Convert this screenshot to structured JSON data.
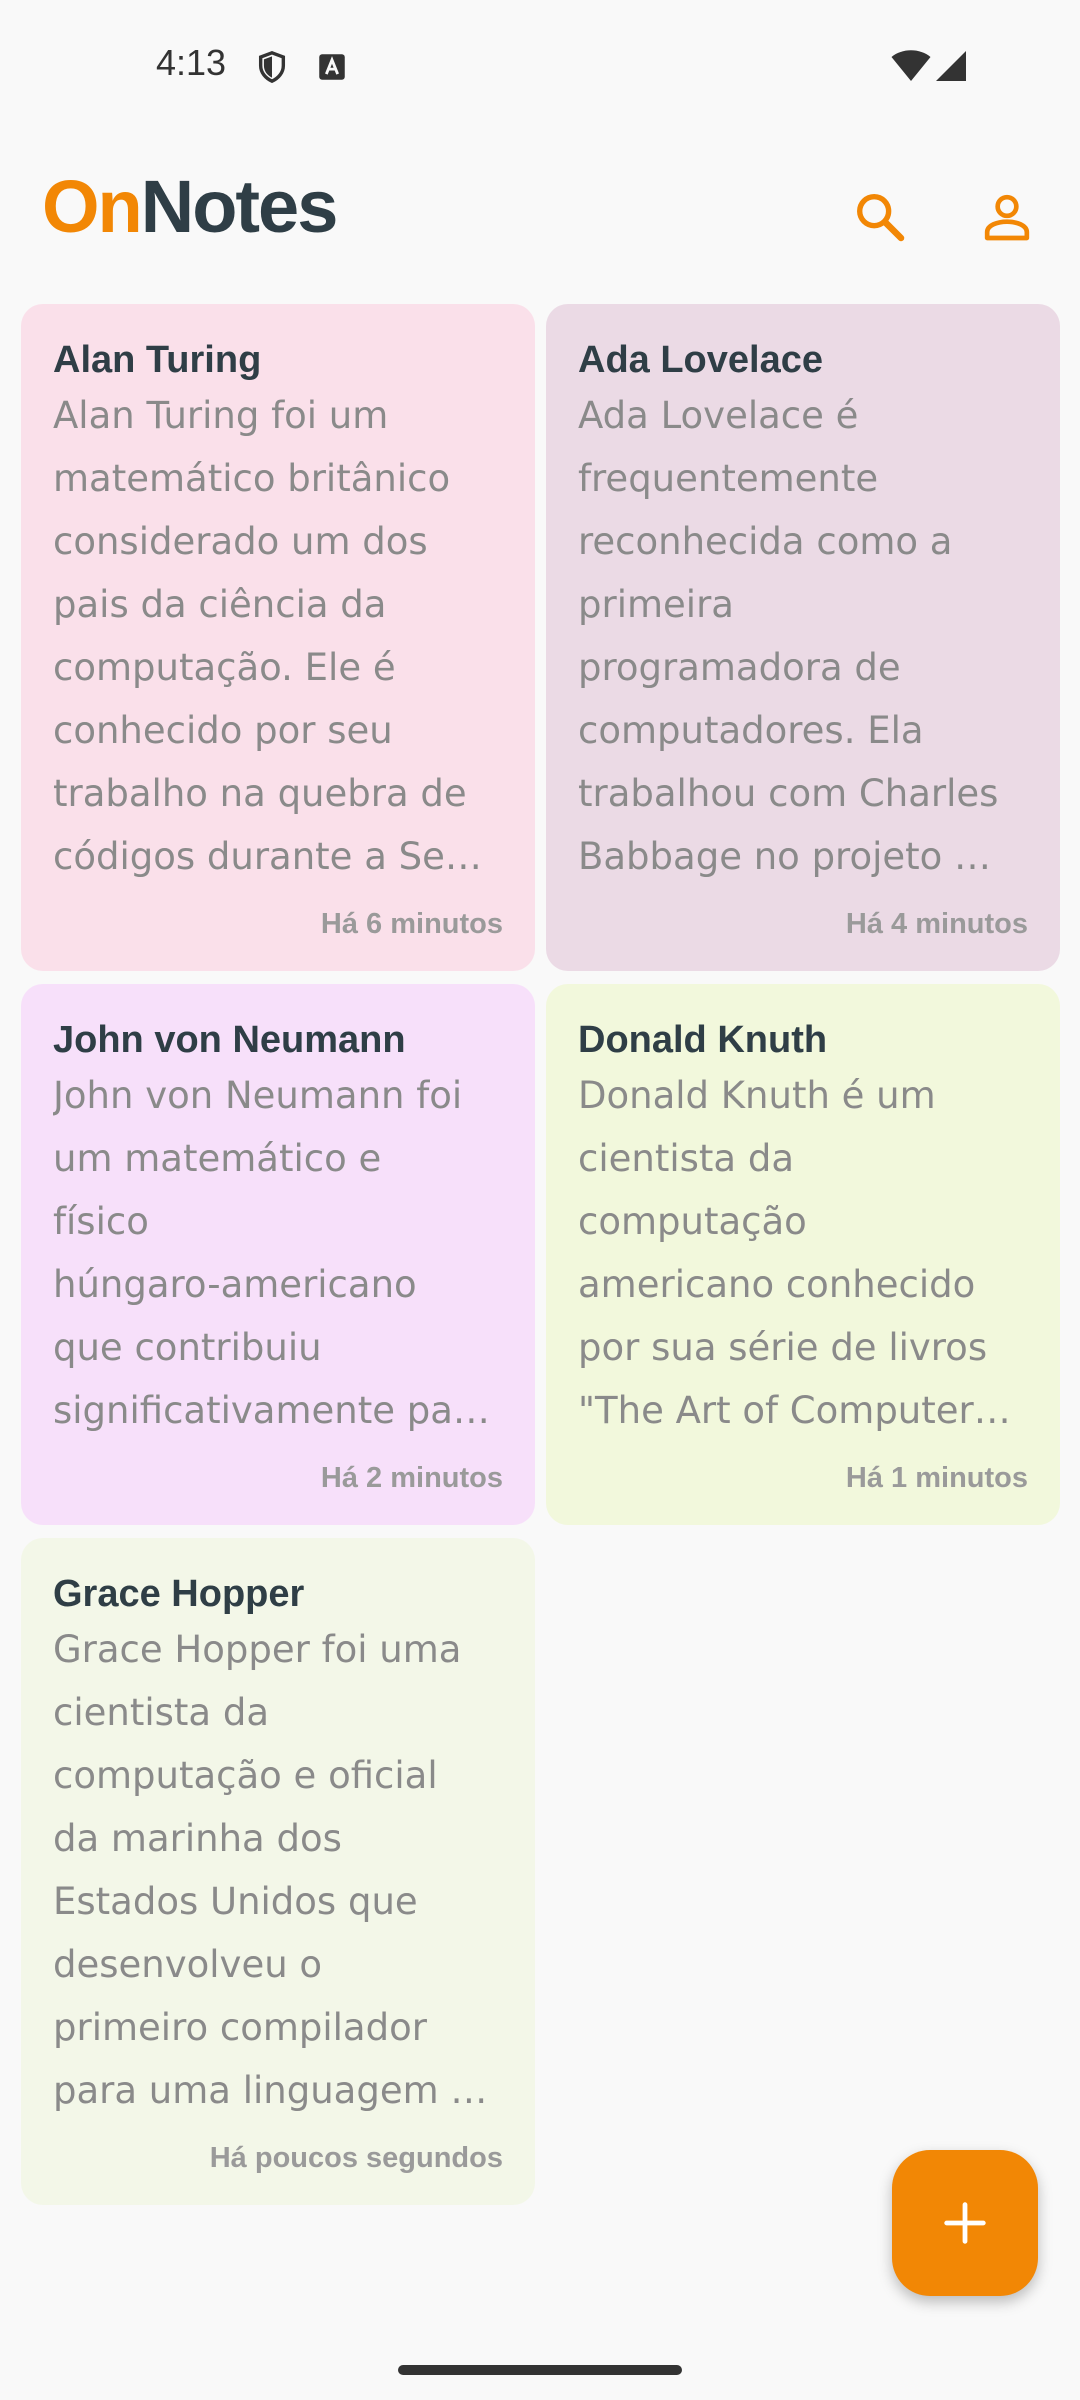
{
  "status_bar": {
    "time": "4:13",
    "icons": [
      "shield-icon",
      "a-text-icon",
      "wifi-icon",
      "signal-icon"
    ]
  },
  "header": {
    "logo_part1": "On",
    "logo_part2": "Notes",
    "actions": [
      "search-icon",
      "profile-icon"
    ]
  },
  "colors": {
    "accent": "#f28705",
    "title_text": "#2f3e46",
    "body_text": "#8a8a8a",
    "background": "#f9f9f9"
  },
  "notes": [
    {
      "title": "Alan Turing",
      "lines": [
        "Alan Turing foi um",
        "matemático britânico",
        "considerado um dos",
        "pais da ciência da",
        "computação. Ele é",
        "conhecido por seu",
        "trabalho na quebra de",
        "códigos durante a Se…"
      ],
      "time": "Há 6 minutos",
      "color": "#fae0ea"
    },
    {
      "title": "Ada Lovelace",
      "lines": [
        "Ada Lovelace é",
        "frequentemente",
        "reconhecida como a",
        "primeira",
        "programadora de",
        "computadores. Ela",
        "trabalhou com Charles",
        "Babbage no projeto …"
      ],
      "time": "Há 4 minutos",
      "color": "#ebdae5"
    },
    {
      "title": "John von Neumann",
      "lines": [
        "John von Neumann foi",
        "um matemático e",
        "físico",
        "húngaro-americano",
        "que contribuiu",
        "significativamente pa…"
      ],
      "time": "Há 2 minutos",
      "color": "#f7e0fa"
    },
    {
      "title": "Donald Knuth",
      "lines": [
        "Donald Knuth é um",
        "cientista da",
        "computação",
        "americano conhecido",
        "por sua série de livros",
        "\"The Art of Computer…"
      ],
      "time": "Há 1 minutos",
      "color": "#f2f8dc"
    },
    {
      "title": "Grace Hopper",
      "lines": [
        "Grace Hopper foi uma",
        "cientista da",
        "computação e oficial",
        "da marinha dos",
        "Estados Unidos que",
        "desenvolveu o",
        "primeiro compilador",
        "para uma linguagem …"
      ],
      "time": "Há poucos segundos",
      "color": "#f3f7e8"
    }
  ],
  "fab": {
    "icon": "plus-icon"
  }
}
